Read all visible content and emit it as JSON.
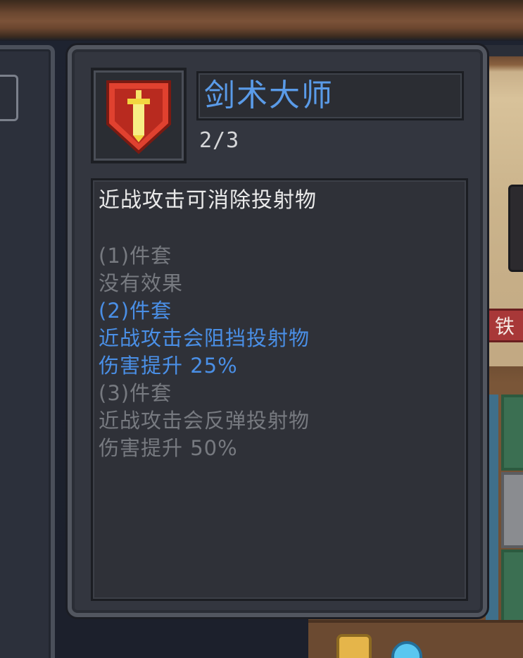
{
  "skill": {
    "name": "剑术大师",
    "level": "2/3",
    "icon": "sword-crest-icon",
    "description": "近战攻击可消除投射物"
  },
  "sets": [
    {
      "header": "(1)件套",
      "lines": [
        "没有效果"
      ],
      "active": false
    },
    {
      "header": "(2)件套",
      "lines": [
        "近战攻击会阻挡投射物",
        "伤害提升 25%"
      ],
      "active": true
    },
    {
      "header": "(3)件套",
      "lines": [
        "近战攻击会反弹投射物",
        "伤害提升 50%"
      ],
      "active": false
    }
  ],
  "background": {
    "right_tag": "铁"
  },
  "colors": {
    "active_text": "#4a8fe6",
    "inactive_text": "#777a80",
    "title_text": "#5a9be8",
    "icon_red": "#d93a2b",
    "icon_gold": "#f2d640"
  }
}
